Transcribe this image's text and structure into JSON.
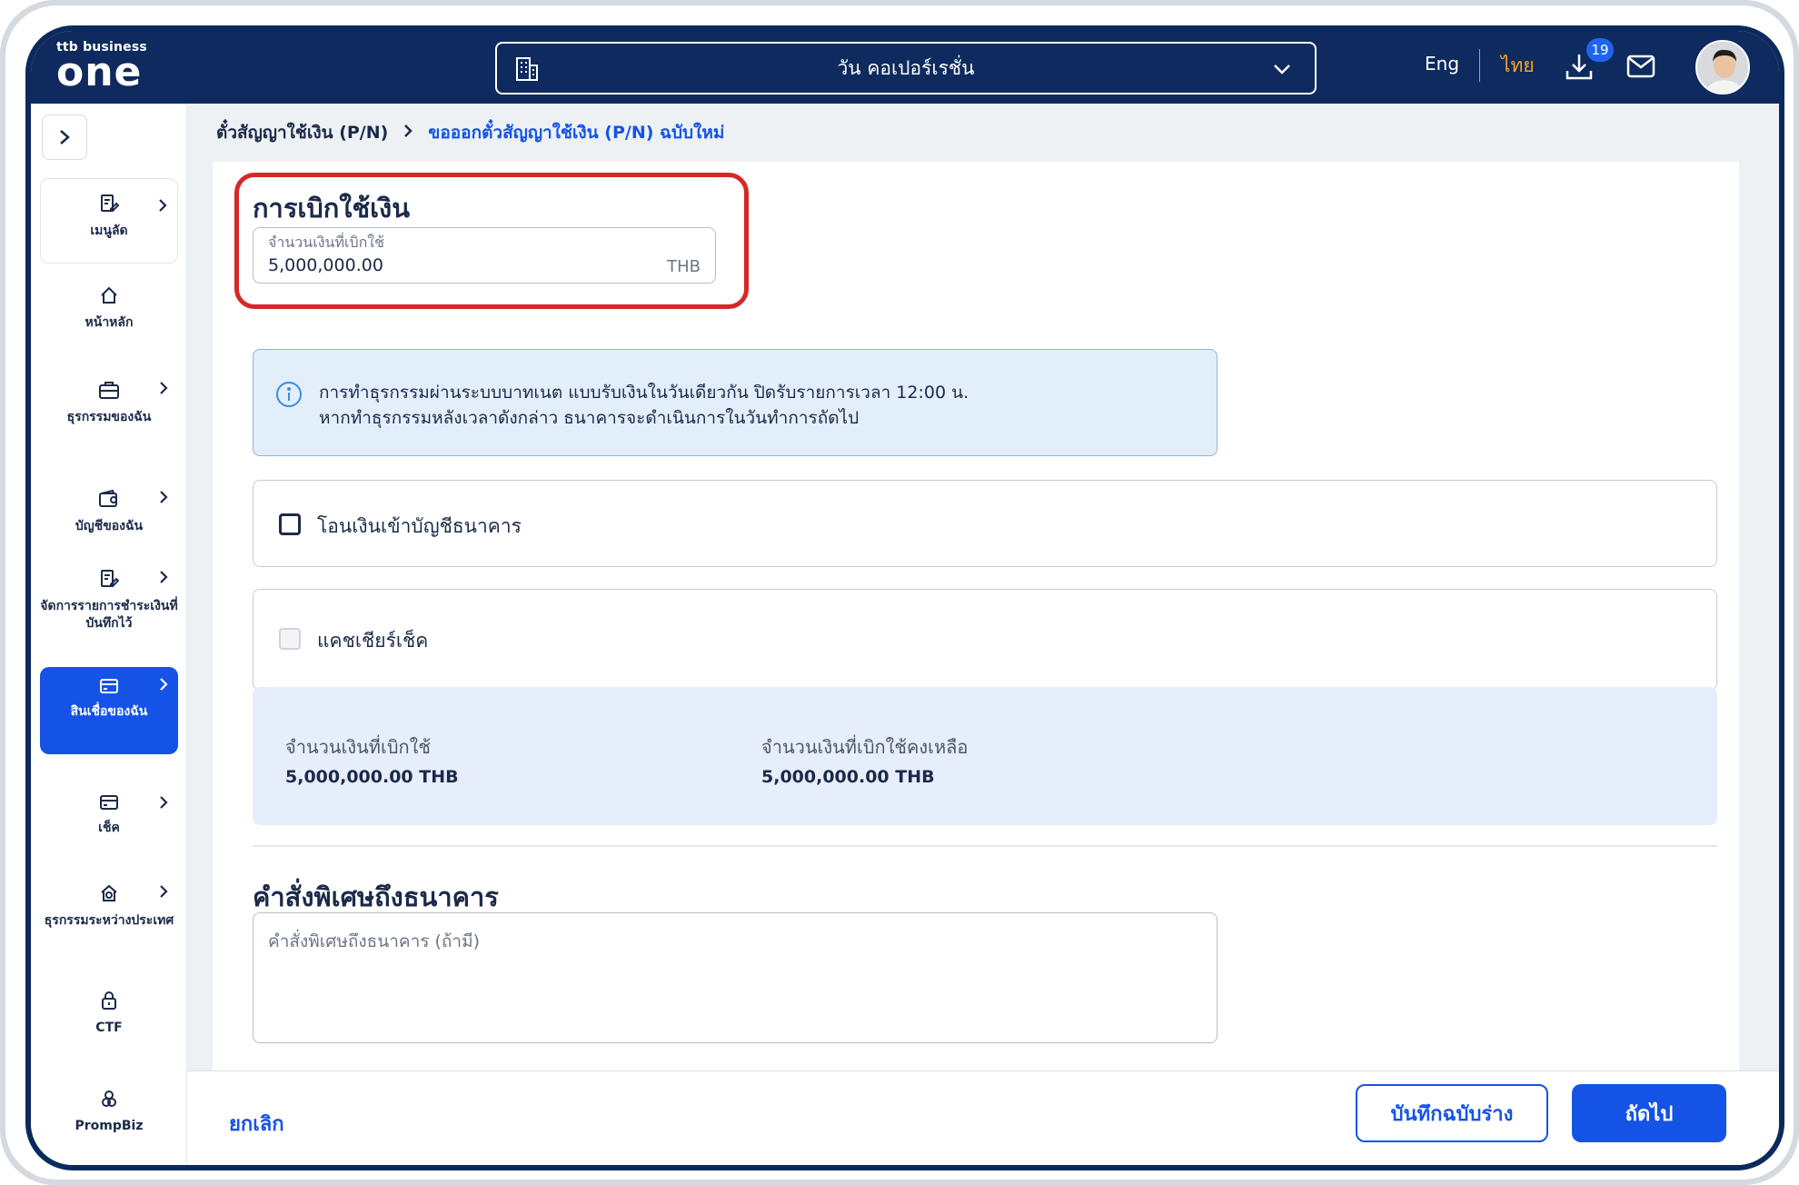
{
  "header": {
    "logo_small": "ttb business",
    "logo_big": "one",
    "company": "วัน คอเปอร์เรชั่น",
    "lang_en": "Eng",
    "lang_th": "ไทย",
    "download_badge": "19",
    "active_lang_color": "#f5a623"
  },
  "sidebar": {
    "items": [
      {
        "label": "เมนูลัด",
        "icon": "document-edit-icon"
      },
      {
        "label": "หน้าหลัก",
        "icon": "home-icon"
      },
      {
        "label": "ธุรกรรมของฉัน",
        "icon": "briefcase-icon"
      },
      {
        "label": "บัญชีของฉัน",
        "icon": "wallet-icon"
      },
      {
        "label": "จัดการรายการชำระเงินที่บันทึกไว้",
        "icon": "document-edit-icon"
      },
      {
        "label": "สินเชื่อของฉัน",
        "icon": "card-icon"
      },
      {
        "label": "เช็ค",
        "icon": "card-icon"
      },
      {
        "label": "ธุรกรรมระหว่างประเทศ",
        "icon": "globe-home-icon"
      },
      {
        "label": "CTF",
        "icon": "lock-icon"
      },
      {
        "label": "PrompBiz",
        "icon": "prompbiz-icon"
      }
    ]
  },
  "breadcrumb": {
    "parent": "ตั๋วสัญญาใช้เงิน (P/N)",
    "current": "ขอออกตั๋วสัญญาใช้เงิน (P/N) ฉบับใหม่"
  },
  "drawdown": {
    "title": "การเบิกใช้เงิน",
    "amount_label": "จำนวนเงินที่เบิกใช้",
    "amount_value": "5,000,000.00",
    "currency": "THB"
  },
  "info": {
    "line1": "การทำธุรกรรมผ่านระบบบาทเนต แบบรับเงินในวันเดียวกัน ปิดรับรายการเวลา 12:00 น.",
    "line2": "หากทำธุรกรรมหลังเวลาดังกล่าว ธนาคารจะดำเนินการในวันทำการถัดไป"
  },
  "options": {
    "transfer_label": "โอนเงินเข้าบัญชีธนาคาร",
    "cashier_label": "แคชเชียร์เช็ค"
  },
  "summary": {
    "drawn_label": "จำนวนเงินที่เบิกใช้",
    "drawn_value": "5,000,000.00 THB",
    "remaining_label": "จำนวนเงินที่เบิกใช้คงเหลือ",
    "remaining_value": "5,000,000.00 THB"
  },
  "instructions": {
    "title": "คำสั่งพิเศษถึงธนาคาร",
    "placeholder": "คำสั่งพิเศษถึงธนาคาร (ถ้ามี)"
  },
  "footer": {
    "cancel": "ยกเลิก",
    "save_draft": "บันทึกฉบับร่าง",
    "next": "ถัดไป"
  }
}
